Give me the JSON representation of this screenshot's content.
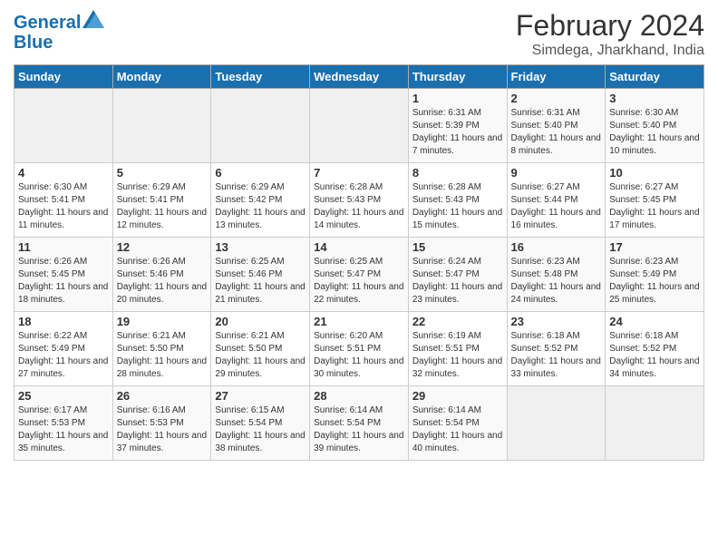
{
  "logo": {
    "line1": "General",
    "line2": "Blue"
  },
  "title": "February 2024",
  "subtitle": "Simdega, Jharkhand, India",
  "days_of_week": [
    "Sunday",
    "Monday",
    "Tuesday",
    "Wednesday",
    "Thursday",
    "Friday",
    "Saturday"
  ],
  "weeks": [
    [
      {
        "day": "",
        "info": ""
      },
      {
        "day": "",
        "info": ""
      },
      {
        "day": "",
        "info": ""
      },
      {
        "day": "",
        "info": ""
      },
      {
        "day": "1",
        "info": "Sunrise: 6:31 AM\nSunset: 5:39 PM\nDaylight: 11 hours and 7 minutes."
      },
      {
        "day": "2",
        "info": "Sunrise: 6:31 AM\nSunset: 5:40 PM\nDaylight: 11 hours and 8 minutes."
      },
      {
        "day": "3",
        "info": "Sunrise: 6:30 AM\nSunset: 5:40 PM\nDaylight: 11 hours and 10 minutes."
      }
    ],
    [
      {
        "day": "4",
        "info": "Sunrise: 6:30 AM\nSunset: 5:41 PM\nDaylight: 11 hours and 11 minutes."
      },
      {
        "day": "5",
        "info": "Sunrise: 6:29 AM\nSunset: 5:41 PM\nDaylight: 11 hours and 12 minutes."
      },
      {
        "day": "6",
        "info": "Sunrise: 6:29 AM\nSunset: 5:42 PM\nDaylight: 11 hours and 13 minutes."
      },
      {
        "day": "7",
        "info": "Sunrise: 6:28 AM\nSunset: 5:43 PM\nDaylight: 11 hours and 14 minutes."
      },
      {
        "day": "8",
        "info": "Sunrise: 6:28 AM\nSunset: 5:43 PM\nDaylight: 11 hours and 15 minutes."
      },
      {
        "day": "9",
        "info": "Sunrise: 6:27 AM\nSunset: 5:44 PM\nDaylight: 11 hours and 16 minutes."
      },
      {
        "day": "10",
        "info": "Sunrise: 6:27 AM\nSunset: 5:45 PM\nDaylight: 11 hours and 17 minutes."
      }
    ],
    [
      {
        "day": "11",
        "info": "Sunrise: 6:26 AM\nSunset: 5:45 PM\nDaylight: 11 hours and 18 minutes."
      },
      {
        "day": "12",
        "info": "Sunrise: 6:26 AM\nSunset: 5:46 PM\nDaylight: 11 hours and 20 minutes."
      },
      {
        "day": "13",
        "info": "Sunrise: 6:25 AM\nSunset: 5:46 PM\nDaylight: 11 hours and 21 minutes."
      },
      {
        "day": "14",
        "info": "Sunrise: 6:25 AM\nSunset: 5:47 PM\nDaylight: 11 hours and 22 minutes."
      },
      {
        "day": "15",
        "info": "Sunrise: 6:24 AM\nSunset: 5:47 PM\nDaylight: 11 hours and 23 minutes."
      },
      {
        "day": "16",
        "info": "Sunrise: 6:23 AM\nSunset: 5:48 PM\nDaylight: 11 hours and 24 minutes."
      },
      {
        "day": "17",
        "info": "Sunrise: 6:23 AM\nSunset: 5:49 PM\nDaylight: 11 hours and 25 minutes."
      }
    ],
    [
      {
        "day": "18",
        "info": "Sunrise: 6:22 AM\nSunset: 5:49 PM\nDaylight: 11 hours and 27 minutes."
      },
      {
        "day": "19",
        "info": "Sunrise: 6:21 AM\nSunset: 5:50 PM\nDaylight: 11 hours and 28 minutes."
      },
      {
        "day": "20",
        "info": "Sunrise: 6:21 AM\nSunset: 5:50 PM\nDaylight: 11 hours and 29 minutes."
      },
      {
        "day": "21",
        "info": "Sunrise: 6:20 AM\nSunset: 5:51 PM\nDaylight: 11 hours and 30 minutes."
      },
      {
        "day": "22",
        "info": "Sunrise: 6:19 AM\nSunset: 5:51 PM\nDaylight: 11 hours and 32 minutes."
      },
      {
        "day": "23",
        "info": "Sunrise: 6:18 AM\nSunset: 5:52 PM\nDaylight: 11 hours and 33 minutes."
      },
      {
        "day": "24",
        "info": "Sunrise: 6:18 AM\nSunset: 5:52 PM\nDaylight: 11 hours and 34 minutes."
      }
    ],
    [
      {
        "day": "25",
        "info": "Sunrise: 6:17 AM\nSunset: 5:53 PM\nDaylight: 11 hours and 35 minutes."
      },
      {
        "day": "26",
        "info": "Sunrise: 6:16 AM\nSunset: 5:53 PM\nDaylight: 11 hours and 37 minutes."
      },
      {
        "day": "27",
        "info": "Sunrise: 6:15 AM\nSunset: 5:54 PM\nDaylight: 11 hours and 38 minutes."
      },
      {
        "day": "28",
        "info": "Sunrise: 6:14 AM\nSunset: 5:54 PM\nDaylight: 11 hours and 39 minutes."
      },
      {
        "day": "29",
        "info": "Sunrise: 6:14 AM\nSunset: 5:54 PM\nDaylight: 11 hours and 40 minutes."
      },
      {
        "day": "",
        "info": ""
      },
      {
        "day": "",
        "info": ""
      }
    ]
  ]
}
